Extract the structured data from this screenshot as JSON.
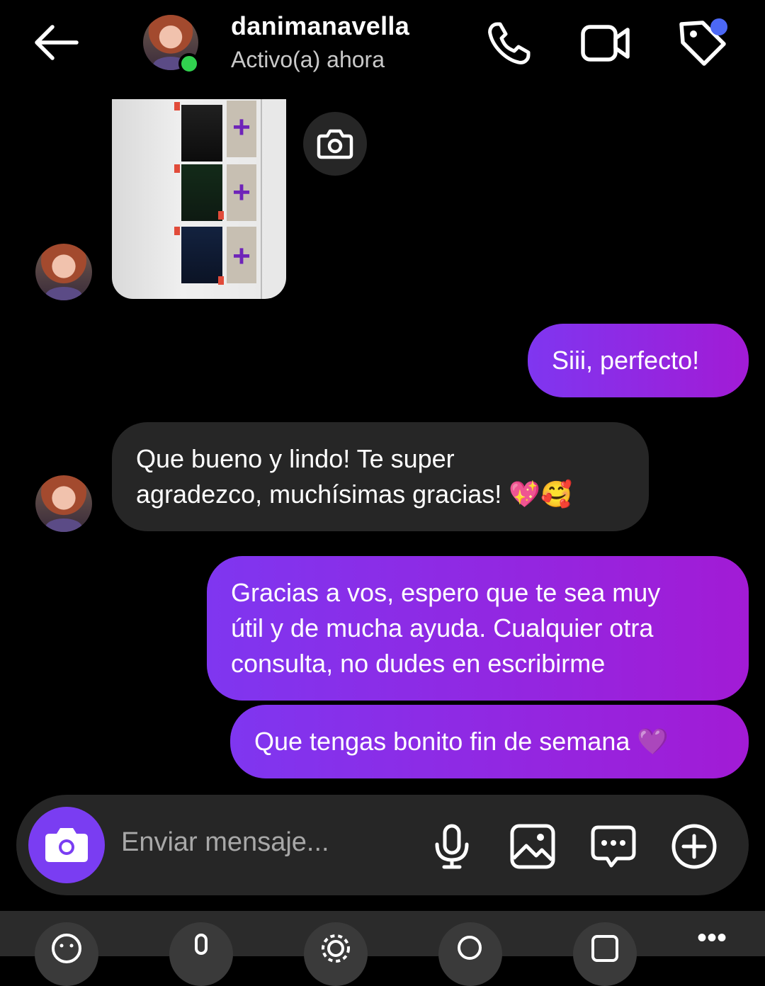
{
  "header": {
    "username": "danimanavella",
    "status": "Activo(a) ahora",
    "icons": [
      "back-arrow-icon",
      "phone-icon",
      "video-camera-icon",
      "tag-icon"
    ]
  },
  "messages": [
    {
      "id": 1,
      "direction": "in",
      "type": "photo"
    },
    {
      "id": 2,
      "direction": "out",
      "text": "Siii, perfecto!"
    },
    {
      "id": 3,
      "direction": "in",
      "text_line1": "Que bueno y lindo! Te super",
      "text_line2": "agradezco, muchísimas gracias! 💖🥰"
    },
    {
      "id": 4,
      "direction": "out",
      "text_line1": "Gracias a vos, espero que te sea muy",
      "text_line2": "útil y de mucha ayuda. Cualquier otra",
      "text_line3": "consulta, no dudes en escribirme"
    },
    {
      "id": 5,
      "direction": "out",
      "text": "Que tengas bonito fin de semana 💜"
    }
  ],
  "composer": {
    "placeholder": "Enviar mensaje..."
  },
  "colors": {
    "background": "#000000",
    "incoming_bubble": "#262626",
    "outgoing_bubble_start": "#7f36f0",
    "outgoing_bubble_end": "#a21bd5",
    "online": "#31d14f",
    "notification": "#4c68f5"
  }
}
